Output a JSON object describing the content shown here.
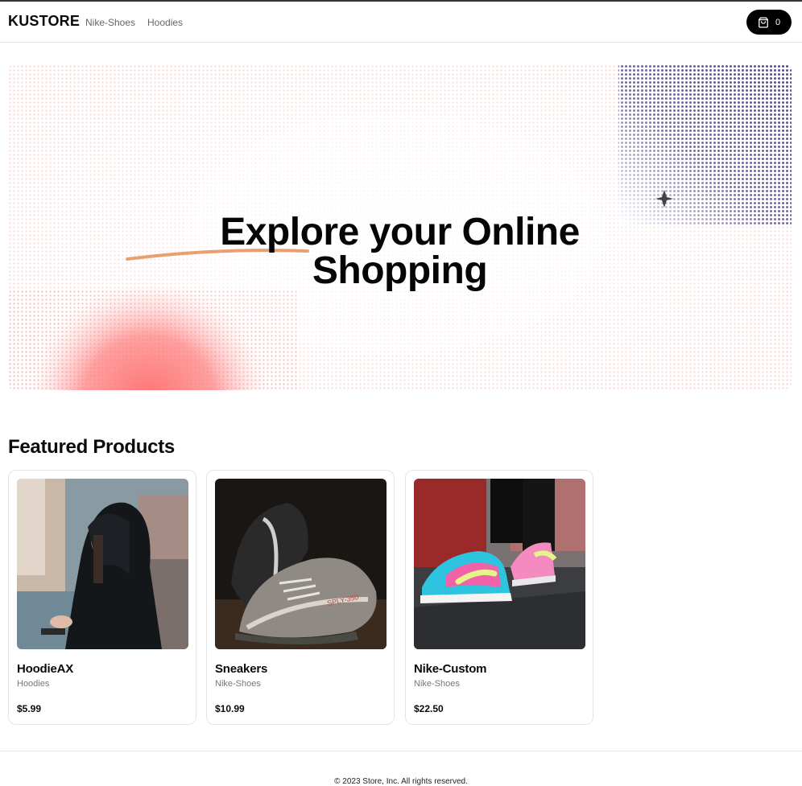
{
  "header": {
    "logo": "KUSTORE",
    "nav": [
      {
        "label": "Nike-Shoes"
      },
      {
        "label": "Hoodies"
      }
    ],
    "cart": {
      "icon": "shopping-bag-icon",
      "count": "0"
    }
  },
  "hero": {
    "title_line1": "Explore your Online",
    "title_line2": "Shopping"
  },
  "featured": {
    "title": "Featured Products",
    "products": [
      {
        "name": "HoodieAX",
        "category": "Hoodies",
        "price": "$5.99",
        "image": "woman-in-black-hoodie-photo"
      },
      {
        "name": "Sneakers",
        "category": "Nike-Shoes",
        "price": "$10.99",
        "image": "grey-yeezy-sneakers-photo"
      },
      {
        "name": "Nike-Custom",
        "category": "Nike-Shoes",
        "price": "$22.50",
        "image": "colorful-nike-sneakers-photo"
      }
    ]
  },
  "footer": {
    "copyright": "© 2023 Store, Inc. All rights reserved."
  },
  "colors": {
    "accent_purple": "#574a8c",
    "accent_coral": "#ff7a7a",
    "brush_orange": "#e8a071",
    "cart_bg": "#000000"
  }
}
